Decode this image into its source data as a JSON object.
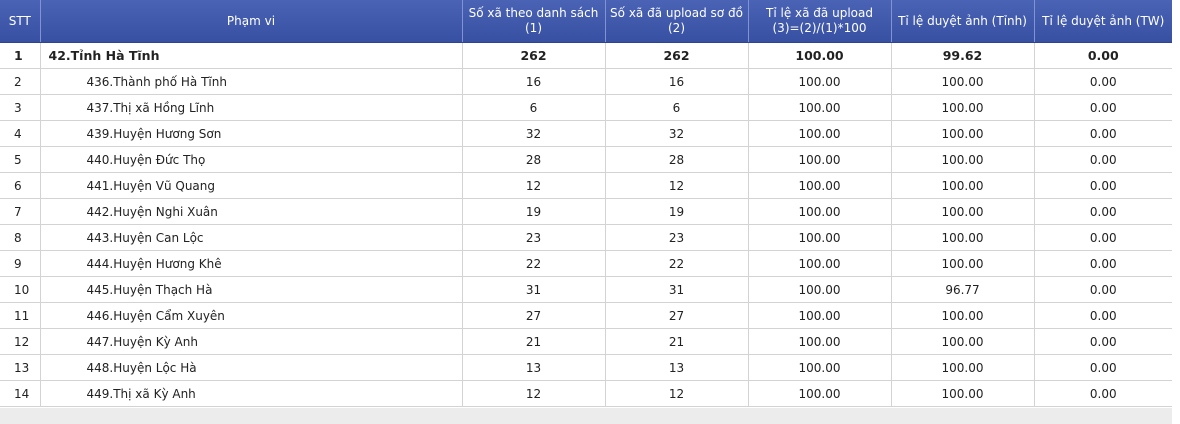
{
  "table": {
    "headers": [
      "STT",
      "Phạm vi",
      "Số xã theo danh sách (1)",
      "Số xã đã upload sơ đồ (2)",
      "Tỉ lệ xã đã upload (3)=(2)/(1)*100",
      "Tỉ lệ duyệt ảnh (Tỉnh)",
      "Tỉ lệ duyệt ảnh (TW)"
    ],
    "rows": [
      {
        "stt": "1",
        "name": "42.Tỉnh Hà Tĩnh",
        "total": 262,
        "uploaded": 262,
        "upload_rate": "100.00",
        "approve_province": "99.62",
        "approve_central": "0.00",
        "is_total": true
      },
      {
        "stt": "2",
        "name": "436.Thành phố Hà Tĩnh",
        "total": 16,
        "uploaded": 16,
        "upload_rate": "100.00",
        "approve_province": "100.00",
        "approve_central": "0.00"
      },
      {
        "stt": "3",
        "name": "437.Thị xã Hồng Lĩnh",
        "total": 6,
        "uploaded": 6,
        "upload_rate": "100.00",
        "approve_province": "100.00",
        "approve_central": "0.00"
      },
      {
        "stt": "4",
        "name": "439.Huyện Hương Sơn",
        "total": 32,
        "uploaded": 32,
        "upload_rate": "100.00",
        "approve_province": "100.00",
        "approve_central": "0.00"
      },
      {
        "stt": "5",
        "name": "440.Huyện Đức Thọ",
        "total": 28,
        "uploaded": 28,
        "upload_rate": "100.00",
        "approve_province": "100.00",
        "approve_central": "0.00"
      },
      {
        "stt": "6",
        "name": "441.Huyện Vũ Quang",
        "total": 12,
        "uploaded": 12,
        "upload_rate": "100.00",
        "approve_province": "100.00",
        "approve_central": "0.00"
      },
      {
        "stt": "7",
        "name": "442.Huyện Nghi Xuân",
        "total": 19,
        "uploaded": 19,
        "upload_rate": "100.00",
        "approve_province": "100.00",
        "approve_central": "0.00"
      },
      {
        "stt": "8",
        "name": "443.Huyện Can Lộc",
        "total": 23,
        "uploaded": 23,
        "upload_rate": "100.00",
        "approve_province": "100.00",
        "approve_central": "0.00"
      },
      {
        "stt": "9",
        "name": "444.Huyện Hương Khê",
        "total": 22,
        "uploaded": 22,
        "upload_rate": "100.00",
        "approve_province": "100.00",
        "approve_central": "0.00"
      },
      {
        "stt": "10",
        "name": "445.Huyện Thạch Hà",
        "total": 31,
        "uploaded": 31,
        "upload_rate": "100.00",
        "approve_province": "96.77",
        "approve_central": "0.00"
      },
      {
        "stt": "11",
        "name": "446.Huyện Cẩm Xuyên",
        "total": 27,
        "uploaded": 27,
        "upload_rate": "100.00",
        "approve_province": "100.00",
        "approve_central": "0.00"
      },
      {
        "stt": "12",
        "name": "447.Huyện Kỳ Anh",
        "total": 21,
        "uploaded": 21,
        "upload_rate": "100.00",
        "approve_province": "100.00",
        "approve_central": "0.00"
      },
      {
        "stt": "13",
        "name": "448.Huyện Lộc Hà",
        "total": 13,
        "uploaded": 13,
        "upload_rate": "100.00",
        "approve_province": "100.00",
        "approve_central": "0.00"
      },
      {
        "stt": "14",
        "name": "449.Thị xã Kỳ Anh",
        "total": 12,
        "uploaded": 12,
        "upload_rate": "100.00",
        "approve_province": "100.00",
        "approve_central": "0.00"
      }
    ]
  },
  "colors": {
    "header_bg": "#3f58ab",
    "header_text": "#ffffff",
    "grid_line": "#d3d3d3",
    "footer_bg": "#ececec"
  }
}
